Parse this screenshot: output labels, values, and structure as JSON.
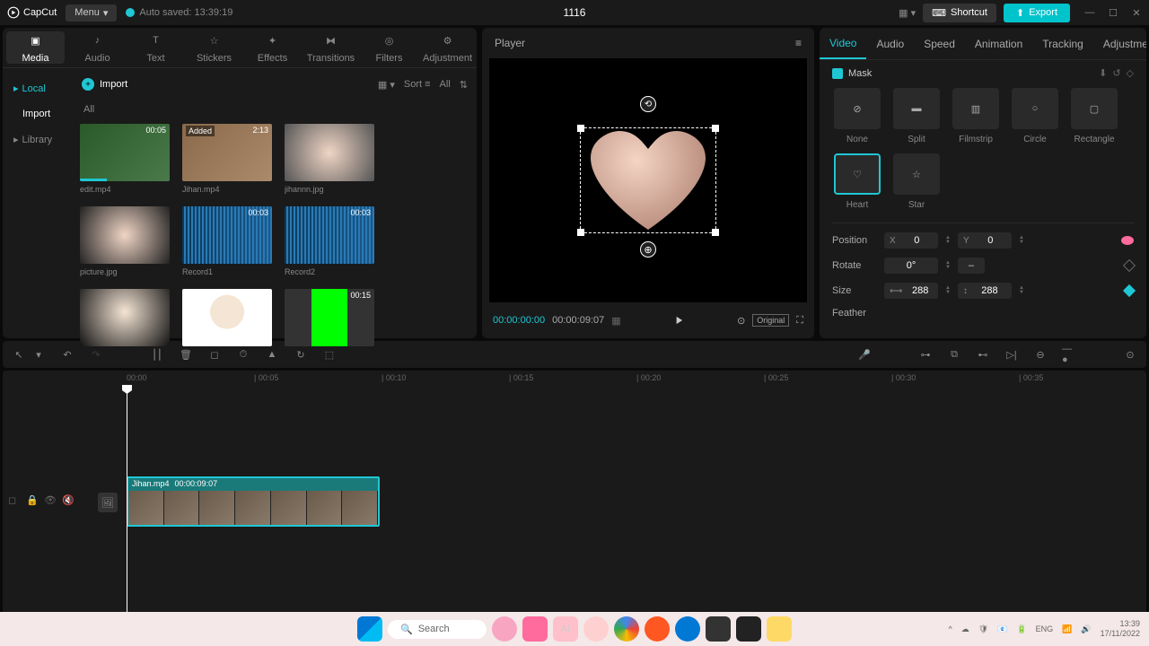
{
  "app": {
    "name": "CapCut",
    "menu": "Menu",
    "autosave": "Auto saved: 13:39:19",
    "title": "1116"
  },
  "titlebar": {
    "shortcut": "Shortcut",
    "export": "Export"
  },
  "topnav": [
    {
      "id": "media",
      "label": "Media"
    },
    {
      "id": "audio",
      "label": "Audio"
    },
    {
      "id": "text",
      "label": "Text"
    },
    {
      "id": "stickers",
      "label": "Stickers"
    },
    {
      "id": "effects",
      "label": "Effects"
    },
    {
      "id": "transitions",
      "label": "Transitions"
    },
    {
      "id": "filters",
      "label": "Filters"
    },
    {
      "id": "adjustment",
      "label": "Adjustment"
    }
  ],
  "mediaSidebar": {
    "local": "Local",
    "import": "Import",
    "library": "Library"
  },
  "mediaHeader": {
    "import": "Import",
    "sort": "Sort",
    "all": "All"
  },
  "mediaAll": "All",
  "thumbs": [
    {
      "name": "edit.mp4",
      "dur": "00:05",
      "bar": true
    },
    {
      "name": "Jihan.mp4",
      "dur": "2:13",
      "badge": "Added"
    },
    {
      "name": "jihannn.jpg",
      "dur": ""
    },
    {
      "name": "picture.jpg",
      "dur": ""
    },
    {
      "name": "Record1",
      "dur": "00:03",
      "wave": true
    },
    {
      "name": "Record2",
      "dur": "00:03",
      "wave": true
    },
    {
      "name": "",
      "dur": ""
    },
    {
      "name": "",
      "dur": ""
    },
    {
      "name": "",
      "dur": "00:15",
      "green": true
    }
  ],
  "player": {
    "title": "Player",
    "tc1": "00:00:00:00",
    "tc2": "00:00:09:07",
    "original": "Original"
  },
  "rpTabs": [
    "Video",
    "Audio",
    "Speed",
    "Animation",
    "Tracking",
    "Adjustment"
  ],
  "mask": {
    "label": "Mask",
    "shapes": [
      "None",
      "Split",
      "Filmstrip",
      "Circle",
      "Rectangle",
      "Heart",
      "Star"
    ]
  },
  "props": {
    "position": {
      "label": "Position",
      "x": "X",
      "xv": "0",
      "y": "Y",
      "yv": "0"
    },
    "rotate": {
      "label": "Rotate",
      "v": "0°"
    },
    "size": {
      "label": "Size",
      "w": "288",
      "h": "288"
    },
    "feather": {
      "label": "Feather"
    }
  },
  "ruler": [
    "00:00",
    "| 00:05",
    "| 00:10",
    "| 00:15",
    "| 00:20",
    "| 00:25",
    "| 00:30",
    "| 00:35"
  ],
  "clip": {
    "name": "Jihan.mp4",
    "dur": "00:00:09:07"
  },
  "taskbar": {
    "search": "Search",
    "time": "13:39",
    "date": "17/11/2022"
  }
}
